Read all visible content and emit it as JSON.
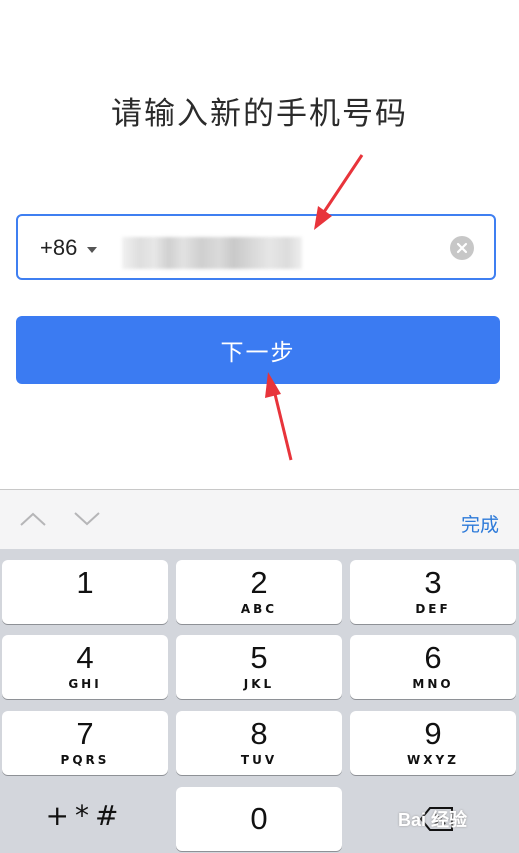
{
  "title": "请输入新的手机号码",
  "phone": {
    "country_code": "+86",
    "value": "",
    "clear_icon": "clear-icon"
  },
  "next_button": "下一步",
  "keyboard": {
    "done": "完成",
    "nav_icons": [
      "chevron-up-icon",
      "chevron-down-icon"
    ],
    "keys": [
      {
        "num": "1",
        "letters": ""
      },
      {
        "num": "2",
        "letters": "ABC"
      },
      {
        "num": "3",
        "letters": "DEF"
      },
      {
        "num": "4",
        "letters": "GHI"
      },
      {
        "num": "5",
        "letters": "JKL"
      },
      {
        "num": "6",
        "letters": "MNO"
      },
      {
        "num": "7",
        "letters": "PQRS"
      },
      {
        "num": "8",
        "letters": "TUV"
      },
      {
        "num": "9",
        "letters": "WXYZ"
      }
    ],
    "symbols": "+*#",
    "zero": "0"
  },
  "watermark": "Bai 经验",
  "colors": {
    "accent": "#3b7bf2",
    "annotation_arrow": "#e8343b",
    "keyboard_bg": "#d3d6dc",
    "done_text": "#2d7ad9"
  }
}
